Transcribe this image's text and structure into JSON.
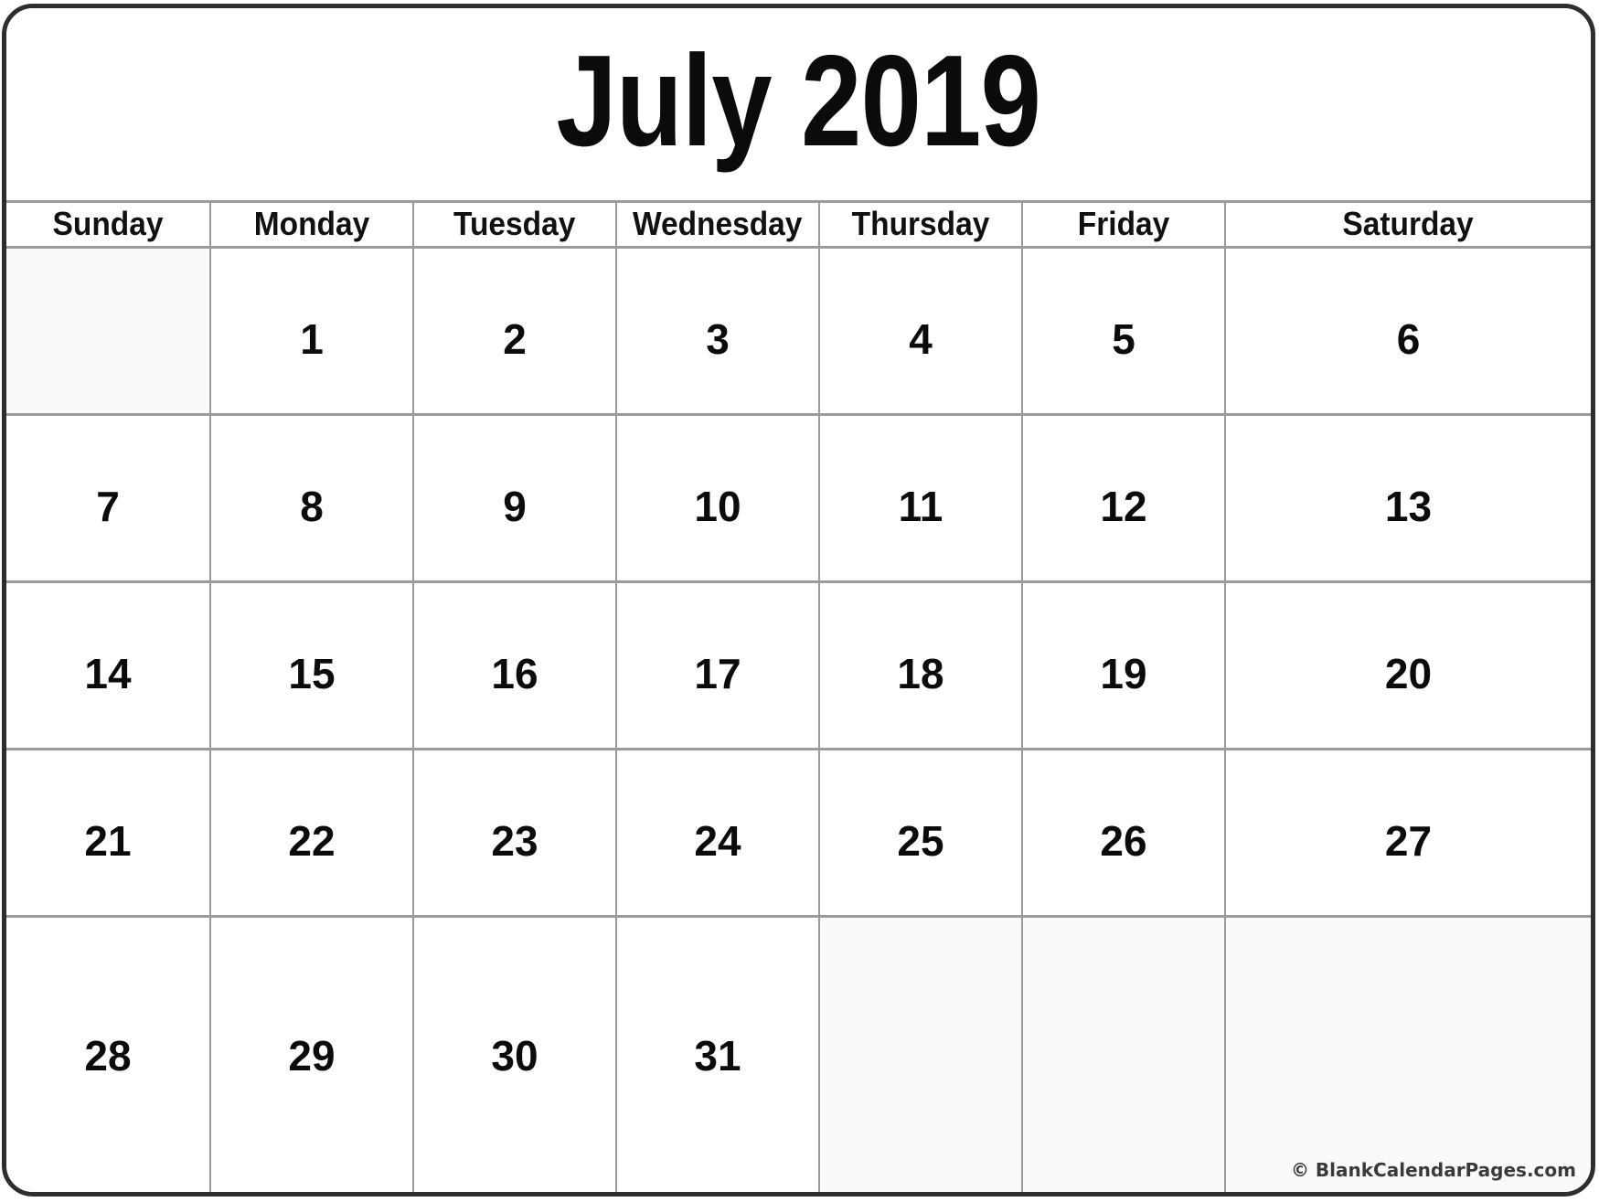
{
  "calendar": {
    "title": "July 2019",
    "month": "July",
    "year": "2019",
    "weekday_headers": [
      "Sunday",
      "Monday",
      "Tuesday",
      "Wednesday",
      "Thursday",
      "Friday",
      "Saturday"
    ],
    "weeks": [
      [
        "",
        "1",
        "2",
        "3",
        "4",
        "5",
        "6"
      ],
      [
        "7",
        "8",
        "9",
        "10",
        "11",
        "12",
        "13"
      ],
      [
        "14",
        "15",
        "16",
        "17",
        "18",
        "19",
        "20"
      ],
      [
        "21",
        "22",
        "23",
        "24",
        "25",
        "26",
        "27"
      ],
      [
        "28",
        "29",
        "30",
        "31",
        "",
        "",
        ""
      ]
    ],
    "first_day_of_week": "Sunday",
    "days_in_month": "31",
    "starts_on": "Monday",
    "copyright": "© BlankCalendarPages.com",
    "colors": {
      "frame_border": "#2e2e2e",
      "grid_line": "#9a9a9a",
      "cell_background": "#ffffff",
      "blank_cell_background": "#fafafa",
      "text": "#0b0b0b",
      "copyright_text": "#3a3a3a"
    }
  }
}
